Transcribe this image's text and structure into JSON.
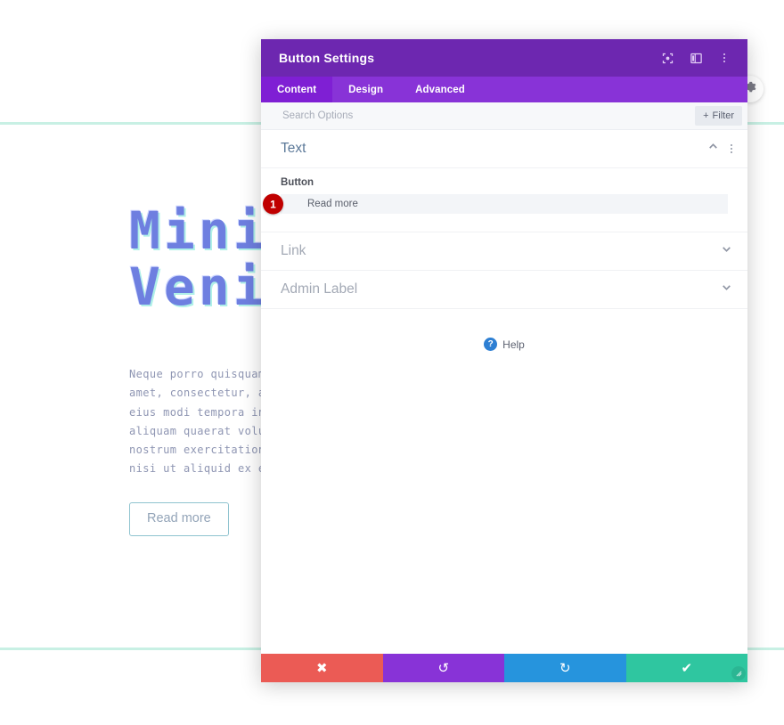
{
  "page": {
    "hero_heading": "Mini\nVeni",
    "hero_body": "Neque porro quisquam es\namet, consectetur, adip\neius modi tempora incid\naliquam quaerat volupta\nnostrum exercitationem\nnisi ut aliquid ex ea c",
    "hero_button_label": "Read more",
    "accent_rule_color": "#c8f0e4",
    "heading_color": "#6e7fe0"
  },
  "modal": {
    "title": "Button Settings",
    "header_icons": [
      {
        "name": "responsive-preview-icon",
        "glyph": "◉"
      },
      {
        "name": "layout-toggle-icon",
        "glyph": "▣"
      },
      {
        "name": "more-options-icon",
        "glyph": "⋮"
      }
    ],
    "tabs": [
      {
        "label": "Content",
        "active": true
      },
      {
        "label": "Design",
        "active": false
      },
      {
        "label": "Advanced",
        "active": false
      }
    ],
    "search": {
      "placeholder": "Search Options",
      "value": ""
    },
    "filter_button": {
      "label": "Filter",
      "plus": "+"
    },
    "sections": [
      {
        "title": "Text",
        "expanded": true,
        "collapse_icon": "chevron-up-icon",
        "options_icon": "section-options-icon"
      },
      {
        "title": "Link",
        "expanded": false,
        "collapse_icon": "chevron-down-icon"
      },
      {
        "title": "Admin Label",
        "expanded": false,
        "collapse_icon": "chevron-down-icon"
      }
    ],
    "button_field": {
      "label": "Button",
      "value": "Read more",
      "placeholder": "Read more",
      "step_badge": "1"
    },
    "help": {
      "label": "Help",
      "icon_glyph": "?"
    },
    "footer": {
      "cancel": {
        "name": "cancel-button",
        "glyph": "✖",
        "color": "#eb5b55"
      },
      "undo": {
        "name": "undo-button",
        "glyph": "↺",
        "color": "#8833d7"
      },
      "redo": {
        "name": "redo-button",
        "glyph": "↻",
        "color": "#2694dd"
      },
      "save": {
        "name": "save-button",
        "glyph": "✔",
        "color": "#2fc6a0"
      }
    },
    "colors": {
      "header": "#6d27b0",
      "tabbar": "#8833d7",
      "tab_active": "#7f1fd4",
      "badge": "#c00000"
    }
  }
}
